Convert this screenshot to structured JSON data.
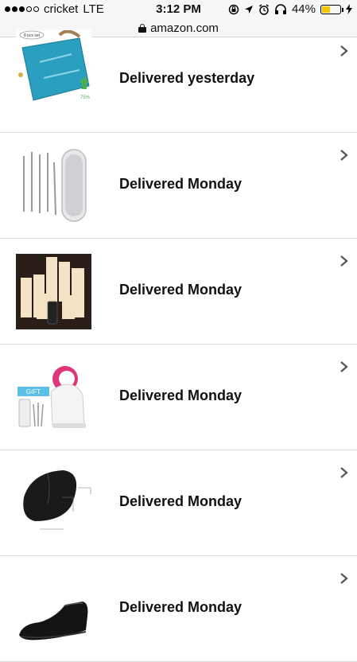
{
  "status_bar": {
    "carrier": "cricket",
    "network": "LTE",
    "time": "3:12 PM",
    "battery": "44%",
    "battery_level": 0.44
  },
  "browser": {
    "url": "amazon.com"
  },
  "orders": [
    {
      "status": "Delivered yesterday",
      "product_icon": "storage-bag-image"
    },
    {
      "status": "Delivered Monday",
      "product_icon": "blackhead-tool-kit-image"
    },
    {
      "status": "Delivered Monday",
      "product_icon": "flameless-candles-image"
    },
    {
      "status": "Delivered Monday",
      "product_icon": "facial-steamer-image"
    },
    {
      "status": "Delivered Monday",
      "product_icon": "wireless-mouse-image"
    },
    {
      "status": "Delivered Monday",
      "product_icon": "leather-shoe-image"
    }
  ],
  "product_image_text": {
    "bag_badge": "8 pcs set",
    "bag_percent": "75%",
    "steamer_gift": "GIFT"
  },
  "colors": {
    "battery": "#f5c400",
    "bag": "#2a9fc0",
    "steamer_accent": "#e0357a"
  }
}
